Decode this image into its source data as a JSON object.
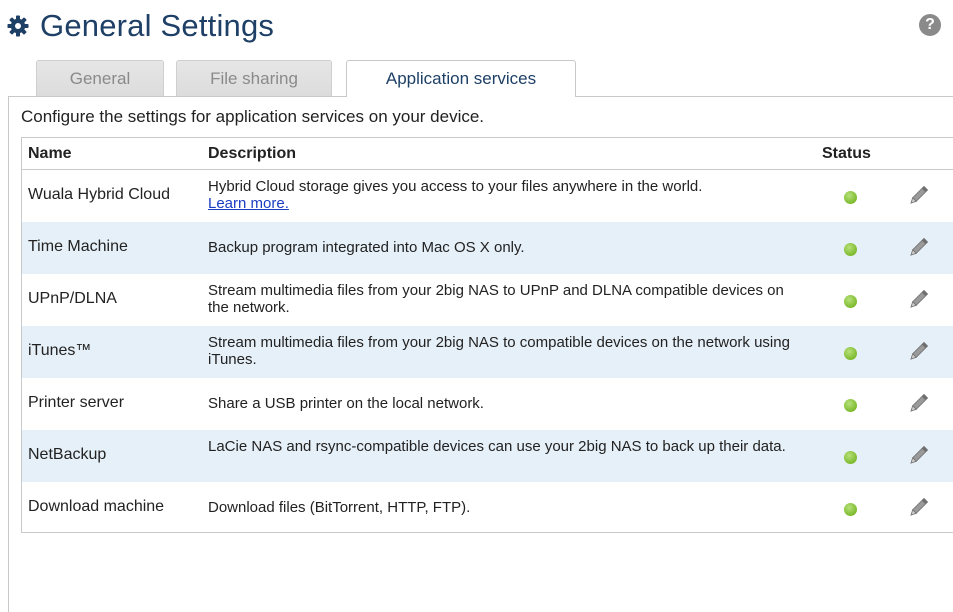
{
  "header": {
    "title": "General Settings",
    "help_icon_text": "?"
  },
  "tabs": [
    {
      "label": "General",
      "active": false
    },
    {
      "label": "File sharing",
      "active": false
    },
    {
      "label": "Application services",
      "active": true
    }
  ],
  "panel": {
    "intro": "Configure the settings for application services on your device."
  },
  "table": {
    "headers": {
      "name": "Name",
      "description": "Description",
      "status": "Status"
    },
    "rows": [
      {
        "name": "Wuala Hybrid Cloud",
        "description": "Hybrid Cloud storage gives you access to your files anywhere in the world.",
        "link": "Learn more.",
        "status": "on"
      },
      {
        "name": "Time Machine",
        "description": "Backup program integrated into Mac OS X only.",
        "status": "on"
      },
      {
        "name": "UPnP/DLNA",
        "description": "Stream multimedia files from your 2big NAS to UPnP and DLNA compatible devices on the network.",
        "status": "on"
      },
      {
        "name": "iTunes™",
        "description": "Stream multimedia files from your 2big NAS to compatible devices on the network using iTunes.",
        "status": "on"
      },
      {
        "name": "Printer server",
        "description": "Share a USB printer on the local network.",
        "status": "on"
      },
      {
        "name": "NetBackup",
        "description": "LaCie NAS and rsync-compatible devices can use your 2big NAS to back up their data.",
        "status": "on"
      },
      {
        "name": "Download machine",
        "description": "Download files (BitTorrent, HTTP, FTP).",
        "status": "on"
      }
    ]
  },
  "colors": {
    "title": "#1e3f66",
    "row_alt": "#e6f0f8",
    "status_on": "#7dbb2e",
    "link": "#1a3dc2"
  },
  "icons": {
    "title": "gear-icon",
    "help": "help-icon",
    "status": "status-dot-icon",
    "edit": "pencil-icon"
  }
}
